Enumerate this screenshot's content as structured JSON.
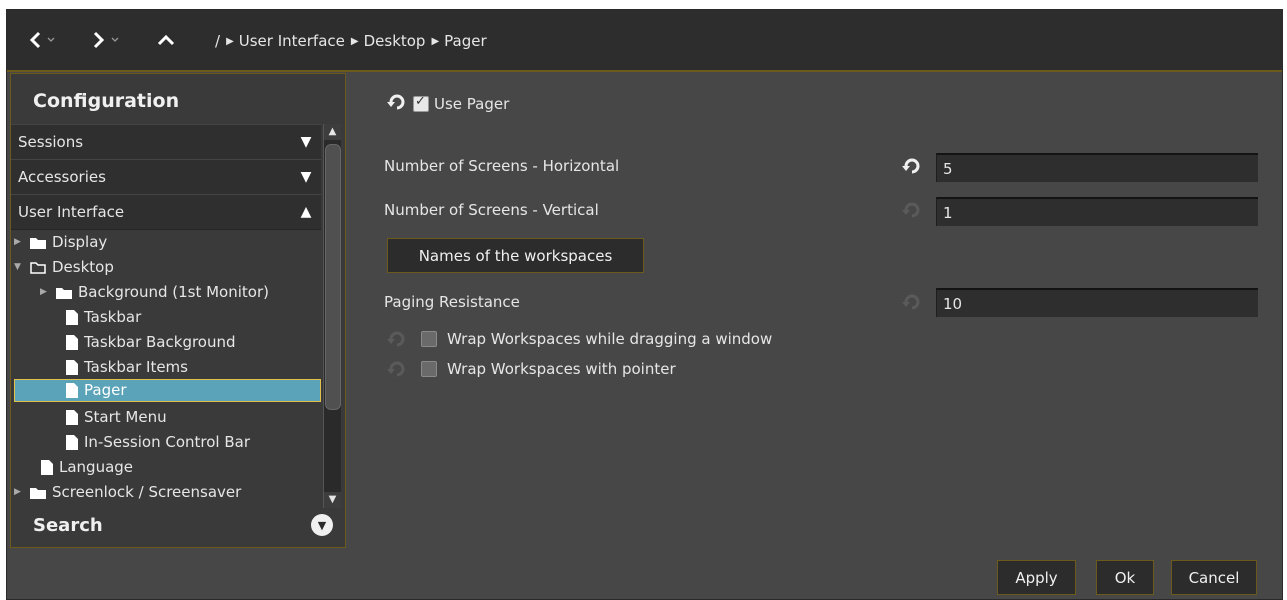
{
  "nav": {
    "breadcrumb_root": "/",
    "breadcrumbs": [
      "User Interface",
      "Desktop",
      "Pager"
    ]
  },
  "sidebar": {
    "title": "Configuration",
    "sections": [
      "Sessions",
      "Accessories",
      "User Interface"
    ],
    "tree": [
      {
        "label": "Display",
        "type": "folder",
        "expander": "▸"
      },
      {
        "label": "Desktop",
        "type": "folder-open",
        "expander": "▾"
      },
      {
        "label": "Background (1st Monitor)",
        "type": "folder",
        "expander": "▸"
      },
      {
        "label": "Taskbar",
        "type": "file"
      },
      {
        "label": "Taskbar Background",
        "type": "file"
      },
      {
        "label": "Taskbar Items",
        "type": "file"
      },
      {
        "label": "Pager",
        "type": "file",
        "selected": true
      },
      {
        "label": "Start Menu",
        "type": "file"
      },
      {
        "label": "In-Session Control Bar",
        "type": "file"
      },
      {
        "label": "Language",
        "type": "file"
      },
      {
        "label": "Screenlock / Screensaver",
        "type": "folder",
        "expander": "▸"
      }
    ],
    "search_label": "Search"
  },
  "settings": {
    "use_pager_label": "Use Pager",
    "use_pager_checked": true,
    "horizontal_label": "Number of Screens - Horizontal",
    "horizontal_value": "5",
    "vertical_label": "Number of Screens - Vertical",
    "vertical_value": "1",
    "workspace_names_button": "Names of the workspaces",
    "resistance_label": "Paging Resistance",
    "resistance_value": "10",
    "wrap_drag_label": "Wrap Workspaces while dragging a window",
    "wrap_drag_checked": false,
    "wrap_pointer_label": "Wrap Workspaces with pointer",
    "wrap_pointer_checked": false
  },
  "footer": {
    "apply": "Apply",
    "ok": "Ok",
    "cancel": "Cancel"
  },
  "colors": {
    "accent_border": "#6b5a1c",
    "selection": "#5aa3b8",
    "selection_border": "#e1c14a"
  }
}
